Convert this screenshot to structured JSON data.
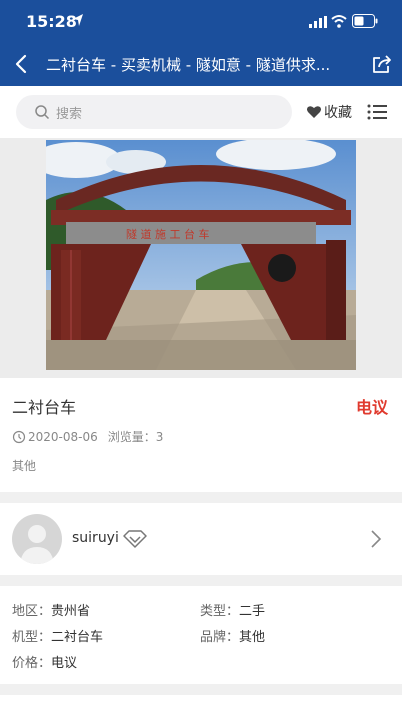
{
  "status_bar": {
    "time": "15:28"
  },
  "nav": {
    "title": "二衬台车 - 买卖机械 - 隧如意 - 隧道供求..."
  },
  "search": {
    "placeholder": "搜索"
  },
  "favorite_label": "收藏",
  "product": {
    "title": "二衬台车",
    "price": "电议",
    "date": "2020-08-06",
    "views_label": "浏览量：",
    "views": "3",
    "tag": "其他"
  },
  "user": {
    "name": "suiruyi"
  },
  "specs": [
    {
      "key": "地区：",
      "value": "贵州省"
    },
    {
      "key": "类型：",
      "value": "二手"
    },
    {
      "key": "机型：",
      "value": "二衬台车"
    },
    {
      "key": "品牌：",
      "value": "其他"
    },
    {
      "key": "价格：",
      "value": "电议"
    }
  ],
  "colors": {
    "nav_bar": "#1b4f9c",
    "price_accent": "#e03a2e"
  }
}
